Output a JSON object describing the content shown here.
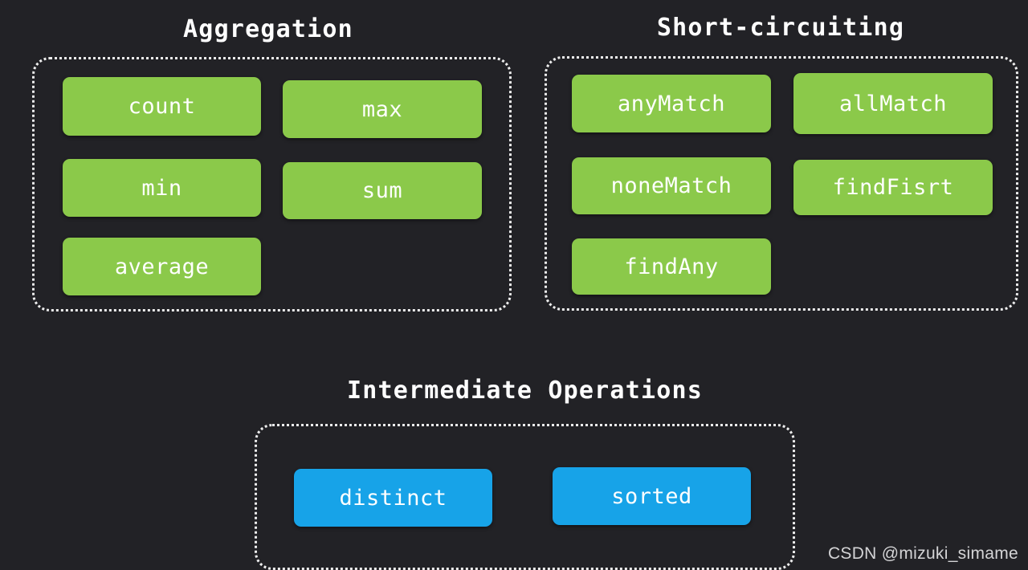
{
  "background_color": "#222226",
  "colors": {
    "green_pill": "#8BC94A",
    "blue_pill": "#17A3E8",
    "panel_border": "#ededed",
    "title_text": "#ffffff",
    "pill_text": "#ffffff",
    "watermark_text": "#d4d4d6"
  },
  "sections": {
    "aggregation": {
      "title": "Aggregation",
      "pill_color": "green",
      "items": [
        {
          "label": "count"
        },
        {
          "label": "max"
        },
        {
          "label": "min"
        },
        {
          "label": "sum"
        },
        {
          "label": "average"
        }
      ]
    },
    "short_circuiting": {
      "title": "Short-circuiting",
      "pill_color": "green",
      "items": [
        {
          "label": "anyMatch"
        },
        {
          "label": "allMatch"
        },
        {
          "label": "noneMatch"
        },
        {
          "label": "findFisrt"
        },
        {
          "label": "findAny"
        }
      ]
    },
    "intermediate_operations": {
      "title": "Intermediate Operations",
      "pill_color": "blue",
      "items": [
        {
          "label": "distinct"
        },
        {
          "label": "sorted"
        }
      ]
    }
  },
  "watermark": "CSDN @mizuki_simame"
}
